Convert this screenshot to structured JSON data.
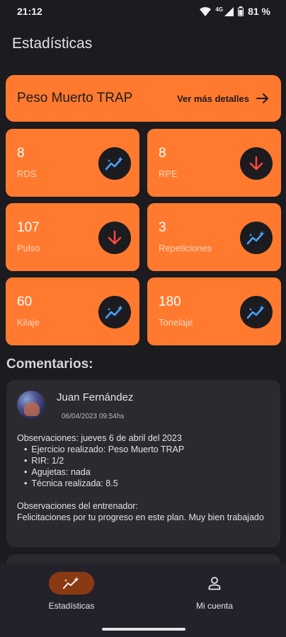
{
  "status_bar": {
    "time": "21:12",
    "network": "4G",
    "battery": "81 %"
  },
  "page": {
    "title": "Estadísticas"
  },
  "exercise": {
    "name": "Peso Muerto TRAP",
    "details_label": "Ver más detalles"
  },
  "stats": [
    {
      "value": "8",
      "label": "RDS",
      "trend": "up"
    },
    {
      "value": "8",
      "label": "RPE",
      "trend": "down"
    },
    {
      "value": "107",
      "label": "Pulso",
      "trend": "down"
    },
    {
      "value": "3",
      "label": "Repeticiones",
      "trend": "up"
    },
    {
      "value": "60",
      "label": "Kilaje",
      "trend": "up"
    },
    {
      "value": "180",
      "label": "Tonelaje",
      "trend": "up"
    }
  ],
  "comments_section": {
    "title": "Comentarios:",
    "comment": {
      "author": "Juan Fernández",
      "date": "06/04/2023 09:54hs",
      "observations_title": "Observaciones: jueves 6 de abril del 2023",
      "bullets": [
        "Ejercicio realizado: Peso Muerto TRAP",
        "RIR: 1/2",
        "Agujetas: nada",
        "Técnica realizada: 8.5"
      ],
      "coach_title": "Observaciones del entrenador:",
      "coach_text": "Felicitaciones por tu progreso en este plan. Muy bien trabajado"
    }
  },
  "bottom_nav": {
    "items": [
      {
        "label": "Estadísticas",
        "icon": "trending-icon",
        "active": true
      },
      {
        "label": "Mi cuenta",
        "icon": "person-icon",
        "active": false
      }
    ]
  },
  "colors": {
    "accent": "#ff7a2f",
    "background": "#1c1b1f",
    "trend_up": "#4aa3ff",
    "trend_down": "#ff4a3d"
  }
}
